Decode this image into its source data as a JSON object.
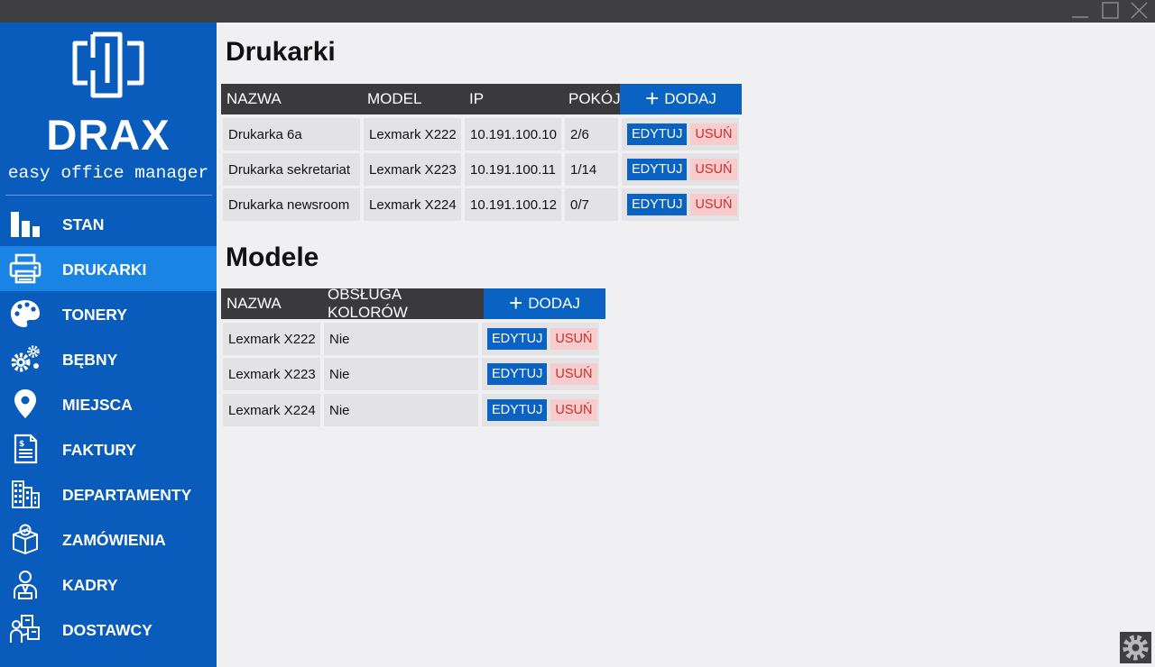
{
  "window": {
    "controls": [
      "minimize-icon",
      "maximize-icon",
      "close-icon"
    ]
  },
  "sidebar": {
    "brand": "DRAX",
    "tagline": "easy office manager",
    "items": [
      {
        "label": "STAN",
        "icon": "bar-chart-icon",
        "active": false
      },
      {
        "label": "DRUKARKI",
        "icon": "printer-icon",
        "active": true
      },
      {
        "label": "TONERY",
        "icon": "palette-icon",
        "active": false
      },
      {
        "label": "BĘBNY",
        "icon": "gears-icon",
        "active": false
      },
      {
        "label": "MIEJSCA",
        "icon": "location-pin-icon",
        "active": false
      },
      {
        "label": "FAKTURY",
        "icon": "invoice-icon",
        "active": false
      },
      {
        "label": "DEPARTAMENTY",
        "icon": "building-icon",
        "active": false
      },
      {
        "label": "ZAMÓWIENIA",
        "icon": "package-icon",
        "active": false
      },
      {
        "label": "KADRY",
        "icon": "employee-icon",
        "active": false
      },
      {
        "label": "DOSTAWCY",
        "icon": "supplier-icon",
        "active": false
      }
    ]
  },
  "printers": {
    "title": "Drukarki",
    "headers": {
      "name": "NAZWA",
      "model": "MODEL",
      "ip": "IP",
      "room": "POKÓJ"
    },
    "add_label": "DODAJ",
    "rows": [
      {
        "name": "Drukarka 6a",
        "model": "Lexmark X222",
        "ip": "10.191.100.10",
        "room": "2/6"
      },
      {
        "name": "Drukarka sekretariat",
        "model": "Lexmark X223",
        "ip": "10.191.100.11",
        "room": "1/14"
      },
      {
        "name": "Drukarka newsroom",
        "model": "Lexmark X224",
        "ip": "10.191.100.12",
        "room": "0/7"
      }
    ]
  },
  "models": {
    "title": "Modele",
    "headers": {
      "name": "NAZWA",
      "color": "OBSŁUGA KOLORÓW"
    },
    "add_label": "DODAJ",
    "rows": [
      {
        "name": "Lexmark X222",
        "color": "Nie"
      },
      {
        "name": "Lexmark X223",
        "color": "Nie"
      },
      {
        "name": "Lexmark X224",
        "color": "Nie"
      }
    ]
  },
  "actions": {
    "edit_label": "EDYTUJ",
    "delete_label": "USUŃ"
  },
  "colors": {
    "sidebar": "#0a5cbc",
    "sidebar_active": "#1a84e4",
    "header_dark": "#3a3a3c",
    "accent": "#0a62c2",
    "delete_bg": "#f8cccc",
    "delete_text": "#cc2b2b"
  }
}
